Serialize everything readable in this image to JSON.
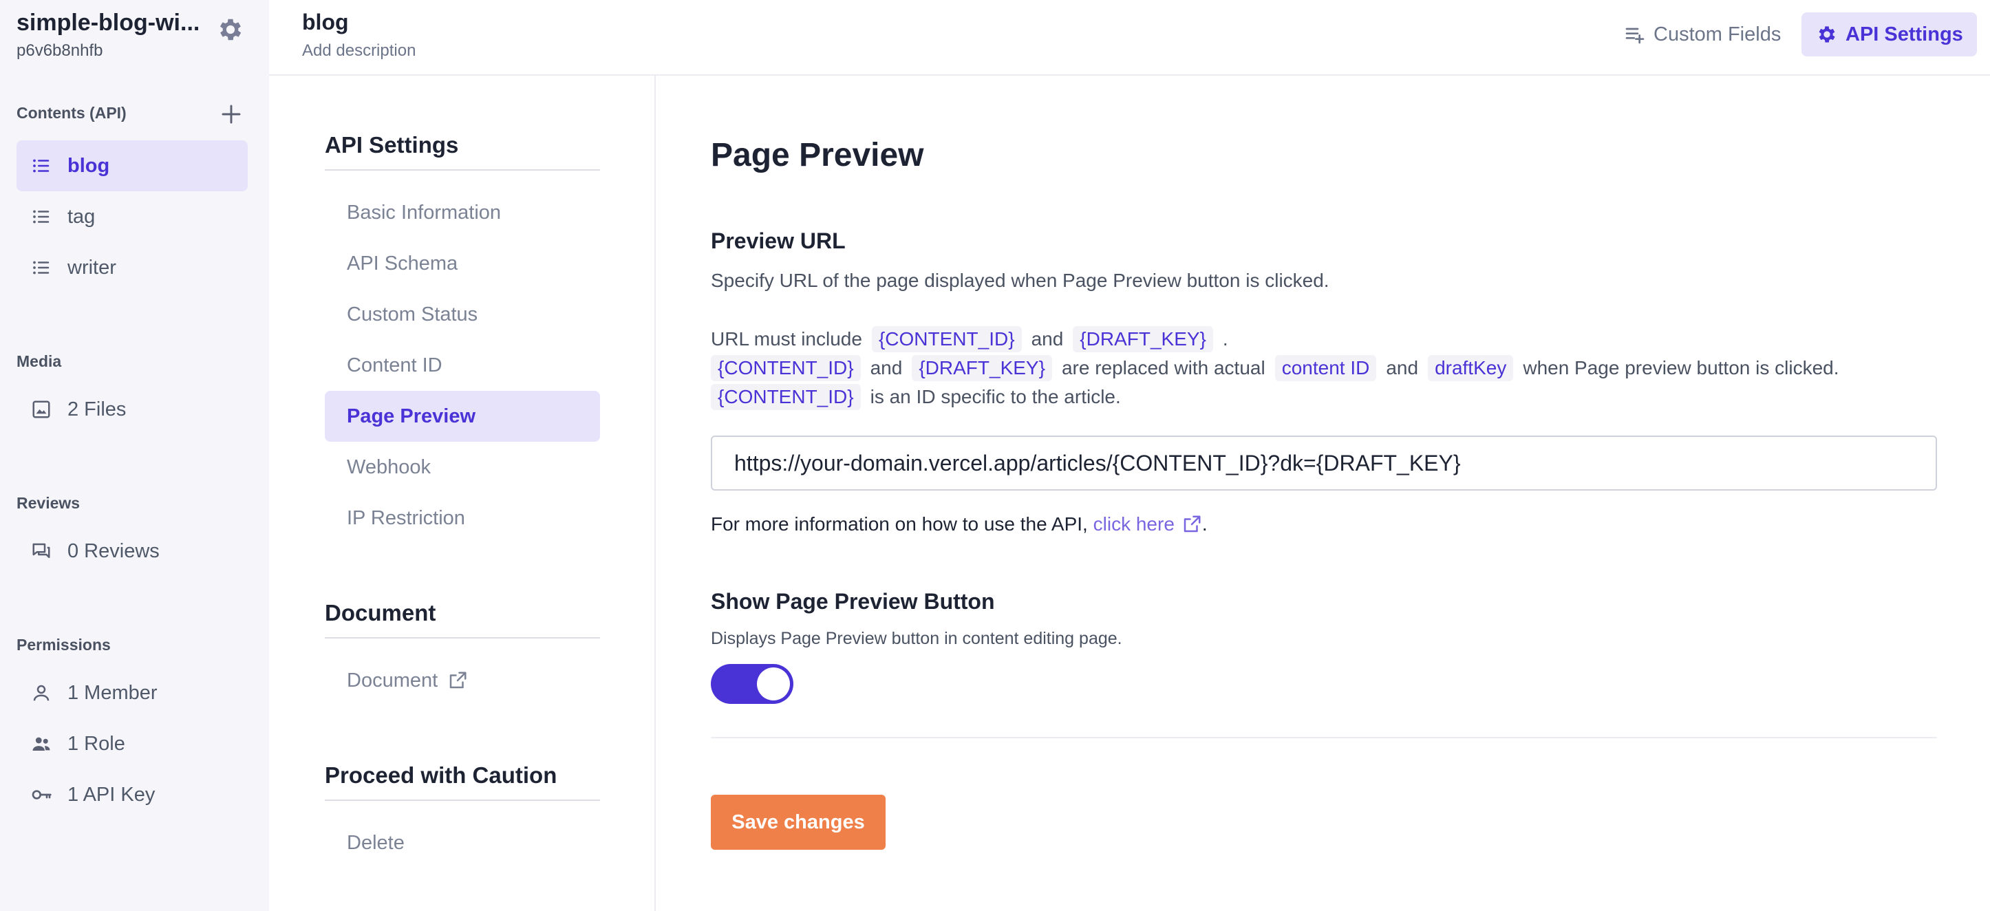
{
  "service": {
    "name": "simple-blog-wi...",
    "id": "p6v6b8nhfb"
  },
  "sidebar": {
    "contents_label": "Contents (API)",
    "apis": [
      {
        "label": "blog",
        "icon": "list-icon",
        "active": true
      },
      {
        "label": "tag",
        "icon": "list-icon",
        "active": false
      },
      {
        "label": "writer",
        "icon": "list-icon",
        "active": false
      }
    ],
    "media_label": "Media",
    "media_item": "2 Files",
    "reviews_label": "Reviews",
    "reviews_item": "0 Reviews",
    "permissions_label": "Permissions",
    "permissions": [
      {
        "label": "1 Member",
        "icon": "user-icon"
      },
      {
        "label": "1 Role",
        "icon": "users-icon"
      },
      {
        "label": "1 API Key",
        "icon": "key-icon"
      }
    ]
  },
  "header": {
    "title": "blog",
    "description": "Add description",
    "custom_fields": "Custom Fields",
    "api_settings": "API Settings"
  },
  "settings_nav": {
    "api_settings_head": "API Settings",
    "items": [
      {
        "label": "Basic Information",
        "active": false
      },
      {
        "label": "API Schema",
        "active": false
      },
      {
        "label": "Custom Status",
        "active": false
      },
      {
        "label": "Content ID",
        "active": false
      },
      {
        "label": "Page Preview",
        "active": true
      },
      {
        "label": "Webhook",
        "active": false
      },
      {
        "label": "IP Restriction",
        "active": false
      }
    ],
    "document_head": "Document",
    "document_item": "Document",
    "caution_head": "Proceed with Caution",
    "delete_item": "Delete"
  },
  "main": {
    "title": "Page Preview",
    "preview_url_head": "Preview URL",
    "preview_url_desc": "Specify URL of the page displayed when Page Preview button is clicked.",
    "line1": {
      "text1": "URL must include",
      "tag1": "{CONTENT_ID}",
      "text2": "and",
      "tag2": "{DRAFT_KEY}",
      "text3": "."
    },
    "line2": {
      "tag1": "{CONTENT_ID}",
      "text1": "and",
      "tag2": "{DRAFT_KEY}",
      "text2": "are replaced with actual",
      "tag3": "content ID",
      "text3": "and",
      "tag4": "draftKey",
      "text4": "when Page preview button is clicked."
    },
    "line3": {
      "tag1": "{CONTENT_ID}",
      "text1": "is an ID specific to the article."
    },
    "url_value": "https://your-domain.vercel.app/articles/{CONTENT_ID}?dk={DRAFT_KEY}",
    "more_info_text": "For more information on how to use the API,",
    "more_info_link": "click here",
    "more_info_end": ".",
    "show_button_head": "Show Page Preview Button",
    "show_button_desc": "Displays Page Preview button in content editing page.",
    "toggle_on": true,
    "save_label": "Save changes"
  },
  "colors": {
    "accent": "#4a33d6",
    "accent_bg": "#e6e3fb",
    "save": "#ef804a",
    "sidebar_bg": "#f6f6fa"
  }
}
